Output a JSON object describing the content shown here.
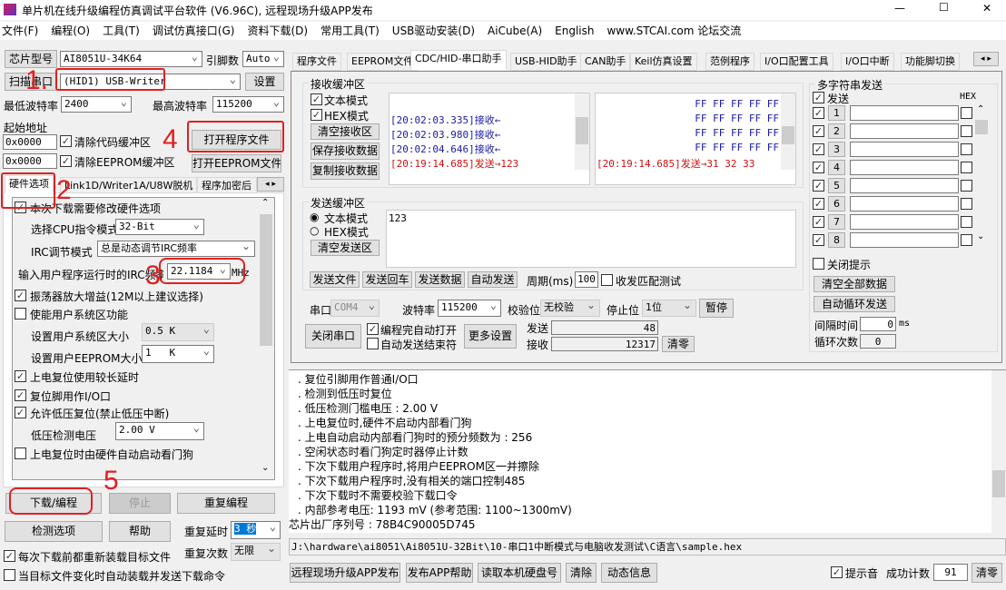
{
  "title": "单片机在线升级编程仿真调试平台软件 (V6.96C), 远程现场升级APP发布",
  "window_controls": {
    "min": "—",
    "max": "☐",
    "close": "✕"
  },
  "menu": [
    "文件(F)",
    "编程(O)",
    "工具(T)",
    "调试仿真接口(G)",
    "资料下载(D)",
    "常用工具(T)",
    "USB驱动安装(D)",
    "AiCube(A)",
    "English",
    "www.STCAI.com 论坛交流"
  ],
  "left": {
    "chip_btn": "芯片型号",
    "chip_value": "AI8051U-34K64",
    "pins_label": "引脚数",
    "pins_value": "Auto",
    "scan_btn": "扫描串口",
    "port_value": "(HID1) USB-Writer",
    "settings_btn": "设置",
    "min_baud_label": "最低波特率",
    "min_baud": "2400",
    "max_baud_label": "最高波特率",
    "max_baud": "115200",
    "start_addr_label": "起始地址",
    "addr1": "0x0000",
    "clear_code": "清除代码缓冲区",
    "addr2": "0x0000",
    "clear_eeprom": "清除EEPROM缓冲区",
    "open_prog": "打开程序文件",
    "open_eeprom": "打开EEPROM文件",
    "tabs": [
      "硬件选项",
      "Link1D/Writer1A/U8W脱机",
      "程序加密后"
    ],
    "hw": {
      "modify": "本次下载需要修改硬件选项",
      "cpu_label": "选择CPU指令模式",
      "cpu_value": "32-Bit",
      "irc_mode_label": "IRC调节模式",
      "irc_mode_value": "总是动态调节IRC频率",
      "irc_freq_label": "输入用户程序运行时的IRC频率",
      "irc_freq_value": "22.1184",
      "mhz": "MHz",
      "osc_gain": "振荡器放大增益(12M以上建议选择)",
      "user_sys": "使能用户系统区功能",
      "sys_size_label": "设置用户系统区大小",
      "sys_size": "0.5 K",
      "eeprom_size_label": "设置用户EEPROM大小",
      "eeprom_size": "1   K",
      "long_delay": "上电复位使用较长延时",
      "reset_io": "复位脚用作I/O口",
      "lvr": "允许低压复位(禁止低压中断)",
      "lv_label": "低压检测电压",
      "lv_value": "2.00 V",
      "wdt": "上电复位时由硬件自动启动看门狗"
    },
    "download_btn": "下载/编程",
    "stop_btn": "停止",
    "repeat_btn": "重复编程",
    "check_btn": "检测选项",
    "help_btn": "帮助",
    "repeat_delay_label": "重复延时",
    "repeat_delay": "3 秒",
    "repeat_count_label": "重复次数",
    "repeat_count": "无限",
    "reload": "每次下载前都重新装载目标文件",
    "auto_load": "当目标文件变化时自动装载并发送下载命令"
  },
  "tabs": [
    "程序文件",
    "EEPROM文件",
    "CDC/HID-串口助手",
    "USB-HID助手",
    "CAN助手",
    "Keil仿真设置",
    "范例程序",
    "I/O口配置工具",
    "I/O口中断",
    "功能脚切换"
  ],
  "recv": {
    "title": "接收缓冲区",
    "text_mode": "文本模式",
    "hex_mode": "HEX模式",
    "clear": "清空接收区",
    "save": "保存接收数据",
    "copy": "复制接收数据",
    "left_lines": [
      {
        "t": "[20:02:03.335]接收←",
        "c": "#1a1aa8"
      },
      {
        "t": "[20:02:03.980]接收←",
        "c": "#1a1aa8"
      },
      {
        "t": "[20:02:04.646]接收←",
        "c": "#1a1aa8"
      },
      {
        "t": "[20:19:14.685]发送→123",
        "c": "#d01010"
      }
    ],
    "right_lines": [
      "FF FF FF FF FF",
      "FF FF FF FF FF",
      "FF FF FF FF FF",
      "FF FF FF FF FF"
    ],
    "right_last": "[20:19:14.685]发送→31 32 33"
  },
  "send": {
    "title": "发送缓冲区",
    "text_mode": "文本模式",
    "hex_mode": "HEX模式",
    "clear": "清空发送区",
    "content": "123",
    "send_file": "发送文件",
    "send_cr": "发送回车",
    "send_data": "发送数据",
    "auto_send": "自动发送",
    "period_label": "周期(ms)",
    "period": "100",
    "match_test": "收发匹配测试"
  },
  "serial": {
    "port_label": "串口",
    "port": "COM4",
    "baud_label": "波特率",
    "baud": "115200",
    "parity_label": "校验位",
    "parity": "无校验",
    "stop_label": "停止位",
    "stop": "1位",
    "pause": "暂停",
    "close": "关闭串口",
    "auto_open": "编程完自动打开",
    "auto_end": "自动发送结束符",
    "more": "更多设置",
    "sent_label": "发送",
    "sent": "48",
    "recv_label": "接收",
    "recv": "12317",
    "clear": "清零"
  },
  "multi": {
    "title": "多字符串发送",
    "send": "发送",
    "hex": "HEX",
    "rows": [
      "1",
      "2",
      "3",
      "4",
      "5",
      "6",
      "7",
      "8"
    ],
    "close_tip": "关闭提示",
    "clear_all": "清空全部数据",
    "auto_loop": "自动循环发送",
    "interval_label": "间隔时间",
    "interval": "0",
    "ms": "ms",
    "loop_label": "循环次数",
    "loop": "0"
  },
  "log": [
    ". 复位引脚用作普通I/O口",
    ". 检测到低压时复位",
    ". 低压检测门槛电压 : 2.00 V",
    ". 上电复位时,硬件不启动内部看门狗",
    ". 上电自动启动内部看门狗时的预分频数为 : 256",
    ". 空闲状态时看门狗定时器停止计数",
    ". 下次下载用户程序时,将用户EEPROM区一并擦除",
    ". 下次下载用户程序时,没有相关的端口控制485",
    ". 下次下载时不需要校验下载口令",
    ". 内部参考电压: 1193 mV (参考范围: 1100~1300mV)",
    "芯片出厂序列号 : 78B4C90005D745"
  ],
  "path": "J:\\hardware\\ai8051\\Ai8051U-32Bit\\10-串口1中断模式与电脑收发测试\\C语言\\sample.hex",
  "bottom": {
    "publish": "远程现场升级APP发布",
    "publish_help": "发布APP帮助",
    "read_disk": "读取本机硬盘号",
    "clear": "清除",
    "dynamic": "动态信息",
    "beep": "提示音",
    "success_label": "成功计数",
    "success": "91",
    "reset": "清零"
  },
  "annotations": [
    "1.",
    "2",
    "3",
    "4",
    "5"
  ]
}
